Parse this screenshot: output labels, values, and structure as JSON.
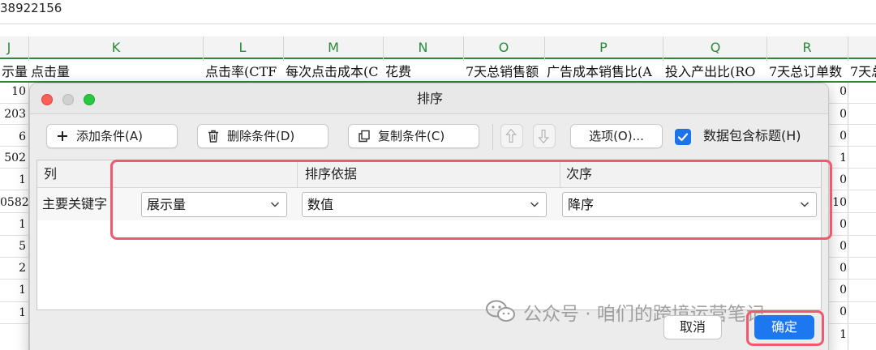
{
  "formula_bar": {
    "value": "38922156"
  },
  "columns": [
    "J",
    "K",
    "L",
    "M",
    "N",
    "O",
    "P",
    "Q",
    "R"
  ],
  "sheet_headers": [
    "示量",
    "点击量",
    "点击率(CTF",
    "每次点击成本(C",
    "花费",
    "7天总销售额",
    "广告成本销售比(A",
    "投入产出比(RO",
    "7天总订单数",
    "7天总"
  ],
  "left_values": [
    "10",
    "203",
    "6",
    "502",
    "1",
    "0582",
    "1",
    "5",
    "2",
    "1",
    "1"
  ],
  "right_values": [
    "0",
    "0",
    "0",
    "1",
    "0",
    "10",
    "0",
    "0",
    "0",
    "0",
    "0",
    "1"
  ],
  "dialog": {
    "title": "排序",
    "toolbar": {
      "add_label": "添加条件(A)",
      "delete_label": "删除条件(D)",
      "copy_label": "复制条件(C)",
      "options_label": "选项(O)...",
      "header_checkbox_label": "数据包含标题(H)",
      "header_checkbox_checked": true
    },
    "grid": {
      "col_header": "列",
      "sort_on_header": "排序依据",
      "order_header": "次序",
      "row": {
        "key_label": "主要关键字",
        "column_value": "展示量",
        "sort_on_value": "数值",
        "order_value": "降序"
      }
    },
    "watermark": "公众号 · 咱们的跨境运营笔记",
    "cancel_label": "取消",
    "ok_label": "确定"
  },
  "colors": {
    "accent": "#1d78f0",
    "highlight": "#ee5a6e",
    "column_header": "#2a8a3a"
  }
}
